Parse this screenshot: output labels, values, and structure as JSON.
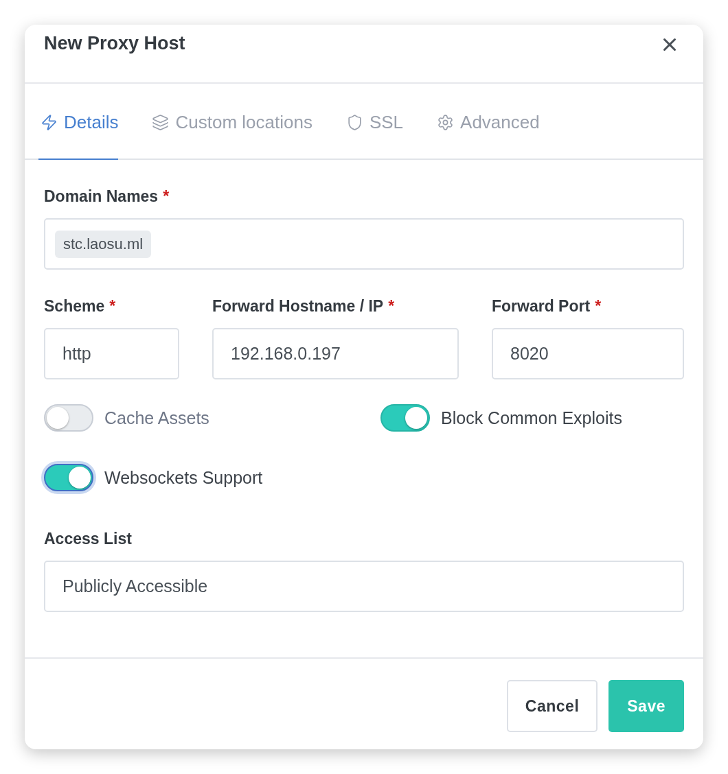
{
  "dialog": {
    "title": "New Proxy Host"
  },
  "tabs": [
    {
      "label": "Details",
      "selected": true
    },
    {
      "label": "Custom locations",
      "selected": false
    },
    {
      "label": "SSL",
      "selected": false
    },
    {
      "label": "Advanced",
      "selected": false
    }
  ],
  "domain_names": {
    "label": "Domain Names",
    "required_mark": "*",
    "tags": [
      "stc.laosu.ml"
    ]
  },
  "forward_fields": [
    {
      "label": "Scheme",
      "required_mark": "*",
      "value": "http"
    },
    {
      "label": "Forward Hostname / IP",
      "required_mark": "*",
      "value": "192.168.0.197"
    },
    {
      "label": "Forward Port",
      "required_mark": "*",
      "value": "8020"
    }
  ],
  "toggles": [
    {
      "label": "Cache Assets",
      "on": false,
      "focused": false
    },
    {
      "label": "Block Common Exploits",
      "on": true,
      "focused": false
    },
    {
      "label": "Websockets Support",
      "on": true,
      "focused": true
    }
  ],
  "access_list": {
    "label": "Access List",
    "value": "Publicly Accessible"
  },
  "buttons": [
    {
      "label": "Cancel",
      "kind": "secondary"
    },
    {
      "label": "Save",
      "kind": "primary"
    }
  ]
}
